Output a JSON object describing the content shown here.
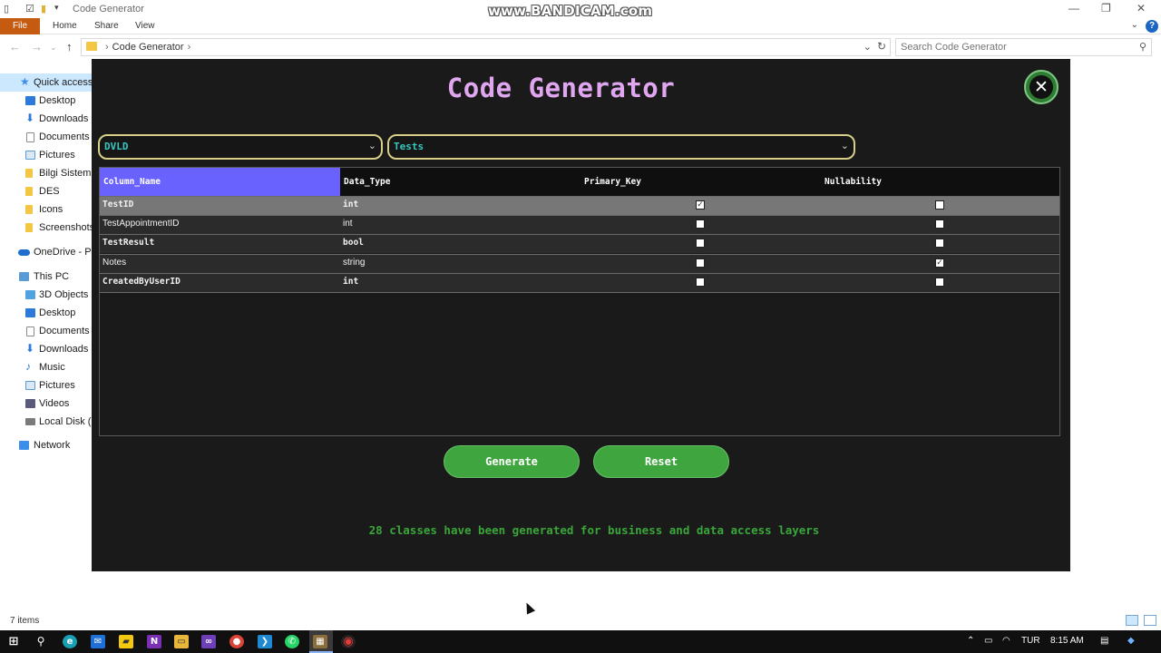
{
  "window": {
    "title": "Code Generator",
    "watermark": "www.BANDICAM.com",
    "ribbon_tabs": [
      "File",
      "Home",
      "Share",
      "View"
    ],
    "help": "?"
  },
  "address": {
    "crumb": "Code Generator",
    "search_placeholder": "Search Code Generator"
  },
  "navpane": {
    "items": [
      {
        "label": "Quick access",
        "color": "#3c8ee8"
      },
      {
        "label": "Desktop",
        "color": "#2b79d8"
      },
      {
        "label": "Downloads",
        "color": "#2b79d8"
      },
      {
        "label": "Documents",
        "color": "#8a8a8a"
      },
      {
        "label": "Pictures",
        "color": "#5b9bd5"
      },
      {
        "label": "Bilgi Sistemleri",
        "color": "#f3c744"
      },
      {
        "label": "DES",
        "color": "#f3c744"
      },
      {
        "label": "Icons",
        "color": "#f3c744"
      },
      {
        "label": "Screenshots",
        "color": "#f3c744"
      },
      {
        "label": "OneDrive - Personal",
        "color": "#1d6ecf"
      },
      {
        "label": "This PC",
        "color": "#5b9bd5"
      },
      {
        "label": "3D Objects",
        "color": "#4fa3e0"
      },
      {
        "label": "Desktop",
        "color": "#2b79d8"
      },
      {
        "label": "Documents",
        "color": "#8a8a8a"
      },
      {
        "label": "Downloads",
        "color": "#2b79d8"
      },
      {
        "label": "Music",
        "color": "#2b79d8"
      },
      {
        "label": "Pictures",
        "color": "#5b9bd5"
      },
      {
        "label": "Videos",
        "color": "#5a5a7a"
      },
      {
        "label": "Local Disk (C:)",
        "color": "#7a7a7a"
      },
      {
        "label": "Network",
        "color": "#3c8ee8"
      }
    ]
  },
  "status": {
    "items_count": "7 items"
  },
  "app": {
    "title": "Code Generator",
    "database_select": "DVLD",
    "table_select": "Tests",
    "columns": [
      "Column_Name",
      "Data_Type",
      "Primary_Key",
      "Nullability"
    ],
    "rows": [
      {
        "name": "TestID",
        "type": "int",
        "pk": true,
        "nullable": false,
        "bold": true
      },
      {
        "name": "TestAppointmentID",
        "type": "int",
        "pk": false,
        "nullable": false,
        "bold": false
      },
      {
        "name": "TestResult",
        "type": "bool",
        "pk": false,
        "nullable": false,
        "bold": true
      },
      {
        "name": "Notes",
        "type": "string",
        "pk": false,
        "nullable": true,
        "bold": false
      },
      {
        "name": "CreatedByUserID",
        "type": "int",
        "pk": false,
        "nullable": false,
        "bold": true
      }
    ],
    "generate_label": "Generate",
    "reset_label": "Reset",
    "status_message": "28 classes have been generated for business and data access layers",
    "colors": {
      "title": "#e0a6f0",
      "accent": "#6a62ff",
      "button": "#3fa63f",
      "message": "#3aa63a"
    }
  },
  "taskbar": {
    "language": "TUR",
    "time": "8:15 AM",
    "apps": [
      "start",
      "search",
      "edge",
      "mail",
      "sticky-notes",
      "onenote",
      "file-explorer",
      "visual-studio",
      "chrome",
      "vs-code",
      "whatsapp",
      "code-generator-app",
      "bandicam"
    ]
  }
}
